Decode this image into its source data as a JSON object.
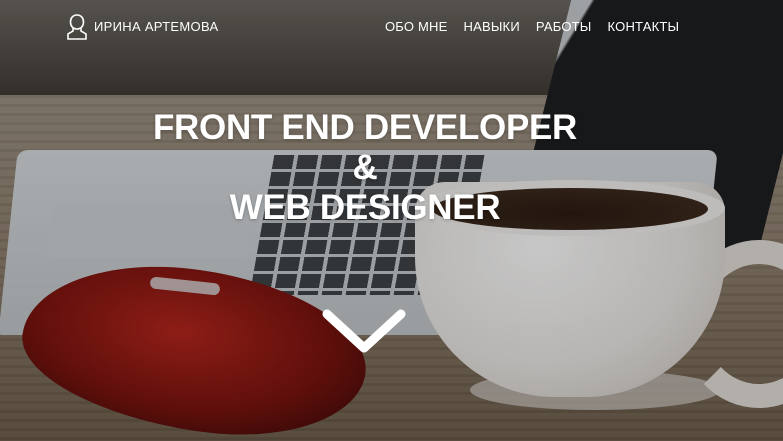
{
  "header": {
    "brand_name": "ИРИНА АРТЕМОВА",
    "brand_icon": "user-silhouette-icon",
    "nav": [
      {
        "label": "ОБО МНЕ"
      },
      {
        "label": "НАВЫКИ"
      },
      {
        "label": "РАБОТЫ"
      },
      {
        "label": "КОНТАКТЫ"
      }
    ]
  },
  "hero": {
    "line1": "FRONT END DEVELOPER",
    "line2": "&",
    "line3": "WEB DESIGNER"
  },
  "scroll_icon": "chevron-down-icon",
  "colors": {
    "text": "#ffffff"
  }
}
